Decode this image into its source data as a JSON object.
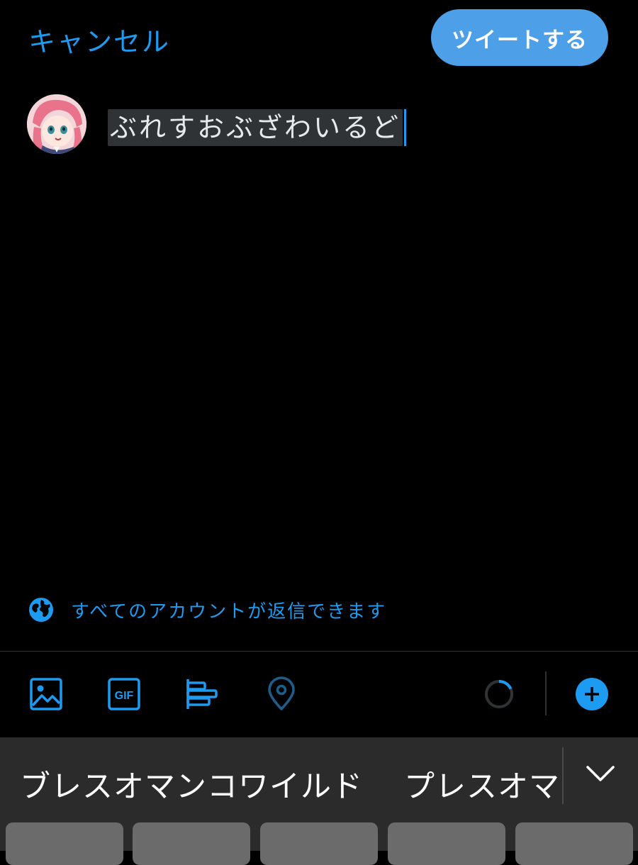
{
  "header": {
    "cancel_label": "キャンセル",
    "tweet_label": "ツイートする"
  },
  "composer": {
    "text": "ぶれすおぶざわいるど"
  },
  "reply_setting": {
    "label": "すべてのアカウントが返信できます",
    "icon": "globe-icon"
  },
  "toolbar": {
    "media_icon": "image-icon",
    "gif_label": "GIF",
    "poll_icon": "poll-icon",
    "location_icon": "location-pin-icon",
    "progress_icon": "character-count-ring",
    "add_icon": "add-thread-icon"
  },
  "keyboard": {
    "suggestions": [
      "ブレスオマンコワイルド",
      "プレスオマ"
    ],
    "collapse_icon": "chevron-down-icon"
  },
  "colors": {
    "accent": "#1d9bf0",
    "button_bg": "#4d9fe8",
    "background": "#000000",
    "keyboard_bg": "#2b2b2b"
  }
}
